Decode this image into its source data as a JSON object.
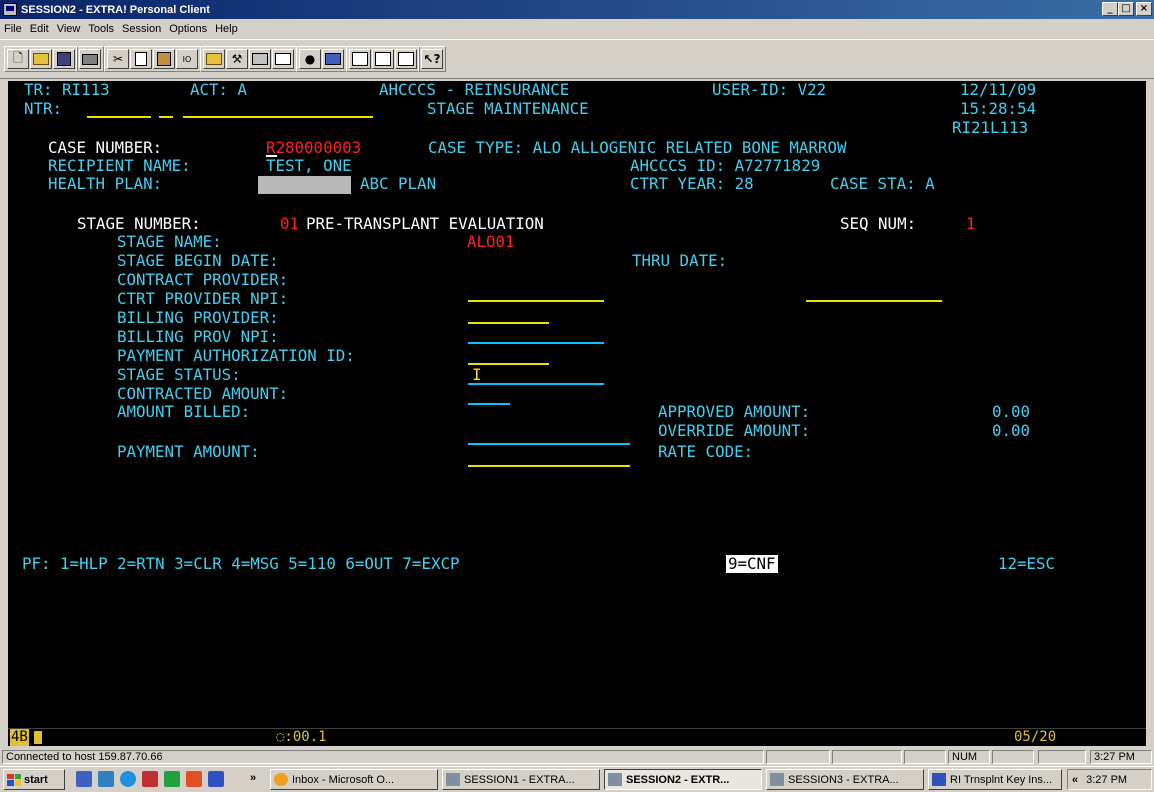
{
  "window": {
    "title": "SESSION2 - EXTRA! Personal Client",
    "buttons": [
      "_",
      "□",
      "×"
    ]
  },
  "menu": [
    "File",
    "Edit",
    "View",
    "Tools",
    "Session",
    "Options",
    "Help"
  ],
  "toolbar": {
    "groups": [
      [
        "new-icon",
        "open-icon",
        "save-icon"
      ],
      [
        "print-icon"
      ],
      [
        "cut-icon",
        "copy-icon",
        "paste-icon",
        "cursor-select-icon"
      ],
      [
        "folder-icon",
        "tools-icon",
        "macro-icon",
        "macro-play-icon"
      ],
      [
        "record-icon",
        "screen-icon"
      ],
      [
        "quickpad-icon",
        "quickpad-alt-icon",
        "quickpad-edit-icon"
      ],
      [
        "help-icon"
      ]
    ]
  },
  "terminal": {
    "header": {
      "tr": "TR: RI113",
      "act": "ACT: A",
      "system": "AHCCCS - REINSURANCE",
      "user_id": "USER-ID: V22",
      "date": "12/11/09",
      "ntr_label": "NTR:",
      "screen_title": "STAGE MAINTENANCE",
      "time": "15:28:54",
      "screen_code": "RI21L113"
    },
    "case": {
      "case_number_label": "CASE NUMBER:",
      "case_number": "R280000003",
      "case_type": "CASE TYPE: ALO ALLOGENIC RELATED BONE MARROW",
      "recipient_label": "RECIPIENT NAME:",
      "recipient": "TEST, ONE",
      "ahcccs_id": "AHCCCS ID: A72771829",
      "health_plan_label": "HEALTH PLAN:",
      "health_plan": "ABC PLAN",
      "ctrt_year": "CTRT YEAR: 28",
      "case_sta": "CASE STA: A"
    },
    "stage": {
      "stage_number_label": "STAGE NUMBER:",
      "stage_number": "01",
      "stage_desc": "PRE-TRANSPLANT EVALUATION",
      "seq_label": "SEQ NUM:",
      "seq": "1",
      "fields": [
        "STAGE NAME:",
        "STAGE BEGIN DATE:",
        "CONTRACT PROVIDER:",
        "CTRT PROVIDER NPI:",
        "BILLING PROVIDER:",
        "BILLING PROV NPI:",
        "PAYMENT AUTHORIZATION ID:",
        "STAGE STATUS:",
        "CONTRACTED AMOUNT:",
        "AMOUNT BILLED:",
        "PAYMENT AMOUNT:"
      ],
      "stage_name": "ALO01",
      "thru_label": "THRU DATE:",
      "stage_status": "I",
      "approved_label": "APPROVED AMOUNT:",
      "approved": "0.00",
      "override_label": "OVERRIDE AMOUNT:",
      "override": "0.00",
      "rate_code_label": "RATE CODE:"
    },
    "pf_keys": {
      "line": "PF: 1=HLP 2=RTN 3=CLR 4=MSG 5=110 6=OUT 7=EXCP",
      "cnf": "9=CNF",
      "esc": "12=ESC"
    }
  },
  "oia": {
    "left": "4B",
    "timer": "◌:00.1",
    "cursor_pos": "05/20"
  },
  "status": {
    "connection": "Connected to host 159.87.70.66",
    "num": "NUM",
    "time": "3:27 PM"
  },
  "taskbar": {
    "start": "start",
    "chevron": "»",
    "tasks": [
      {
        "label": "Inbox - Microsoft O...",
        "icon": "outlook-icon"
      },
      {
        "label": "SESSION1 - EXTRA...",
        "icon": "extra-icon"
      },
      {
        "label": "SESSION2 - EXTR...",
        "icon": "extra-icon"
      },
      {
        "label": "SESSION3 - EXTRA...",
        "icon": "extra-icon"
      },
      {
        "label": "RI Trnsplnt Key Ins...",
        "icon": "word-icon"
      }
    ],
    "tray_chevron": "«",
    "clock": "3:27 PM"
  }
}
